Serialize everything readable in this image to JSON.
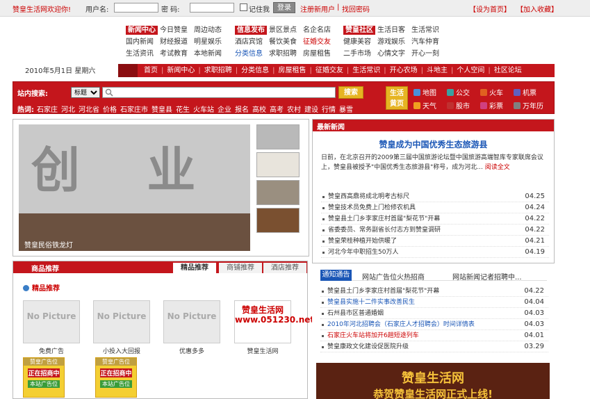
{
  "topbar": {
    "welcome": "赞皇生活网欢迎你!",
    "username_label": "用户名:",
    "password_label": "密  码:",
    "remember_label": "记住我",
    "login_button": "登录",
    "register_link": "注册新用户",
    "separator": "|",
    "recover_link": "找回密码",
    "set_home": "【设为首页】",
    "add_fav": "【加入收藏】"
  },
  "news_nav": {
    "tag": "新闻中心",
    "rows": [
      [
        "今日赞皇",
        "周边动态"
      ],
      [
        "国内新闻",
        "财经报道",
        "明星娱乐"
      ],
      [
        "生活资讯",
        "考试教育",
        "本地新闻"
      ]
    ]
  },
  "info_nav": {
    "tag": "信息发布",
    "rows": [
      [
        "景区景点",
        "名企名店"
      ],
      [
        "酒店宾馆",
        "餐饮美食",
        "征婚交友"
      ],
      [
        "分类信息",
        "求职招聘",
        "房屋租售"
      ]
    ]
  },
  "community_nav": {
    "tag": "赞皇社区",
    "rows": [
      [
        "生活日客",
        "生活常识"
      ],
      [
        "健康美容",
        "游戏娱乐",
        "汽车仲育"
      ],
      [
        "二手市场",
        "心情文字",
        "开心一刻"
      ]
    ]
  },
  "date_text": "2010年5月1日  星期六",
  "main_nav": [
    "首页",
    "新闻中心",
    "求职招聘",
    "分类信息",
    "房屋租售",
    "征婚交友",
    "生活常识",
    "开心农场",
    "斗地主",
    "个人空间",
    "社区论坛"
  ],
  "search": {
    "label": "站内搜索:",
    "select_value": "标题",
    "button": "搜索",
    "hot_label": "热词:",
    "hot_words": [
      "石家庄",
      "河北",
      "河北省",
      "价格",
      "石家庄市",
      "赞皇县",
      "花生",
      "火车站",
      "企业",
      "报名",
      "高校",
      "高考",
      "农村",
      "建设",
      "行情",
      "暴雪"
    ],
    "life_label_1": "生活",
    "life_label_2": "黄页",
    "tools": [
      {
        "name": "地图",
        "color": "#4a90d9"
      },
      {
        "name": "公交",
        "color": "#3aa0a0"
      },
      {
        "name": "火车",
        "color": "#e06020"
      },
      {
        "name": "机票",
        "color": "#6060c0"
      },
      {
        "name": "天气",
        "color": "#f0a020"
      },
      {
        "name": "股市",
        "color": "#c03030"
      },
      {
        "name": "彩票",
        "color": "#d04080"
      },
      {
        "name": "万年历",
        "color": "#808080"
      }
    ]
  },
  "slider": {
    "bg_text": "创 业",
    "caption": "赞皇民俗铁龙灯"
  },
  "latest": {
    "title": "最新新闻",
    "headline": "赞皇成为中国优秀生态旅游县",
    "summary": "    日前，在北京召开的2009第三届中国旅游论坛暨中国旅游高端智库专家联席会议上，赞皇县被授予\"中国优秀生态旅游县\"称号，成为河北...",
    "more": "阅读全文",
    "items": [
      {
        "title": "赞皇西高鼎将成北明考古标尺",
        "date": "04.25"
      },
      {
        "title": "赞皇技术员免费上门检修农机具",
        "date": "04.24"
      },
      {
        "title": "赞皇县土门乡李家庄村首届\"梨花节\"开幕",
        "date": "04.22"
      },
      {
        "title": "省委委员、常务副省长付志方到赞皇调研",
        "date": "04.22"
      },
      {
        "title": "赞皇荣桂种植开始供暖了",
        "date": "04.21"
      },
      {
        "title": "河北今年中职招生50万人",
        "date": "04.19"
      }
    ]
  },
  "notice": {
    "tag": "通知通告",
    "n1": "网站广告位火热招商",
    "n2": "网站新闻记者招聘中...",
    "items": [
      {
        "title": "赞皇县土门乡李家庄村首届\"梨花节\"开幕",
        "date": "04.22",
        "style": ""
      },
      {
        "title": "赞皇县实施十二件实事改善民生",
        "date": "04.04",
        "style": "blue"
      },
      {
        "title": "石州县市区普通婚姻",
        "date": "04.03",
        "style": ""
      },
      {
        "title": "2010年河北招聘会（石家庄人才招聘会）时间详情表",
        "date": "04.03",
        "style": "blue"
      },
      {
        "title": "石家庄火车站将加开6趟短途列车",
        "date": "04.01",
        "style": "red"
      },
      {
        "title": "赞皇康政文化建设促医院升级",
        "date": "03.29",
        "style": ""
      }
    ]
  },
  "goods": {
    "title": "商品推荐",
    "tabs": [
      "精品推荐",
      "商铺推荐",
      "酒店推荐"
    ],
    "sub": "精品推荐",
    "items": [
      {
        "pic": "No Picture",
        "name": "免费广告"
      },
      {
        "pic": "No Picture",
        "name": "小投入大回报"
      },
      {
        "pic": "No Picture",
        "name": "优惠多多"
      },
      {
        "pic": "赞皇生活网 www.051230.net",
        "name": "赞皇生活网"
      }
    ],
    "ad": {
      "a1": "赞皇广告位",
      "a2": "正在招商中",
      "a3": "本站广告位"
    }
  },
  "banner": {
    "line1": "赞皇生活网",
    "line2": "恭贺赞皇生活网正式上线!"
  }
}
